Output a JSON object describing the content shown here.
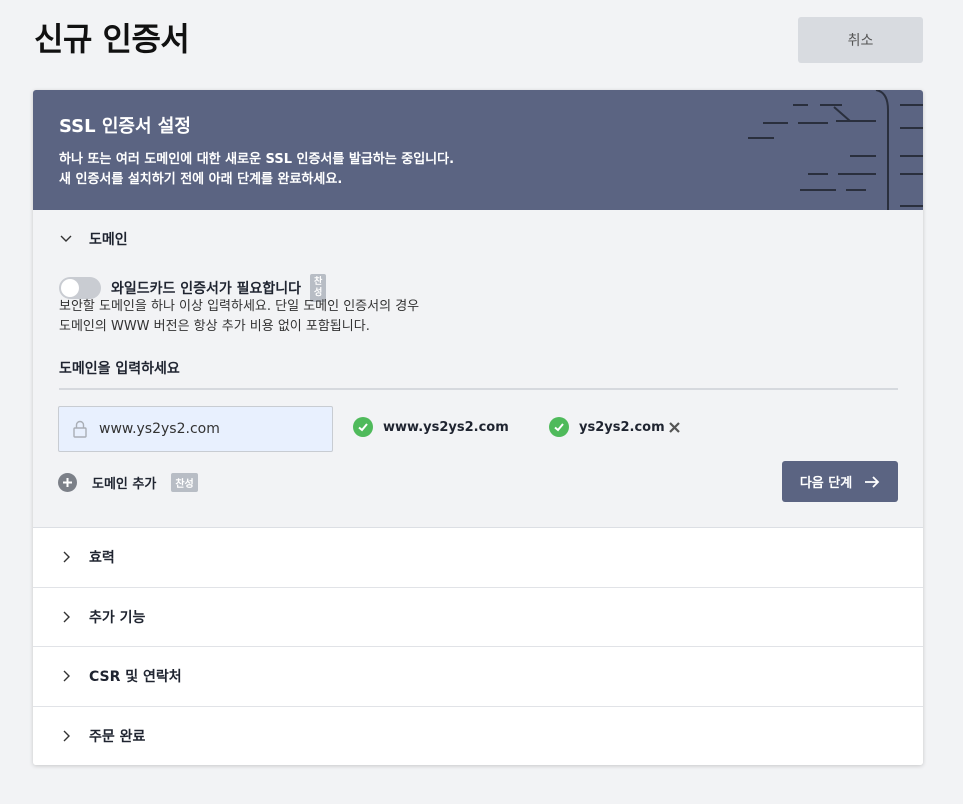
{
  "page": {
    "title": "신규 인증서",
    "cancel_label": "취소"
  },
  "banner": {
    "title": "SSL 인증서 설정",
    "line1": "하나 또는 여러 도메인에 대한 새로운 SSL 인증서를 발급하는 중입니다.",
    "line2": "새 인증서를 설치하기 전에 아래 단계를 완료하세요."
  },
  "domain_section": {
    "label": "도메인",
    "wildcard_label": "와일드카드 인증서가 필요합니다",
    "wildcard_badge_line1": "찬",
    "wildcard_badge_line2": "성",
    "help_line1": "보안할 도메인을 하나 이상 입력하세요. 단일 도메인 인증서의 경우",
    "help_line2": "도메인의 WWW 버전은 항상 추가 비용 없이 포함됩니다.",
    "enter_label": "도메인을 입력하세요",
    "input_value": "www.ys2ys2.com",
    "chips": [
      "www.ys2ys2.com",
      "ys2ys2.com"
    ],
    "add_label": "도메인 추가",
    "add_badge": "찬성",
    "next_label": "다음 단계"
  },
  "sections": [
    {
      "label": "효력"
    },
    {
      "label": "추가 기능"
    },
    {
      "label": "CSR 및 연락처"
    },
    {
      "label": "주문 완료"
    }
  ],
  "colors": {
    "banner": "#5b6482",
    "success": "#4fba5b",
    "background": "#f2f3f5"
  },
  "icons": [
    "chevron-down-icon",
    "chevron-right-icon",
    "lock-icon",
    "check-circle-icon",
    "close-icon",
    "plus-circle-icon",
    "arrow-right-icon"
  ]
}
